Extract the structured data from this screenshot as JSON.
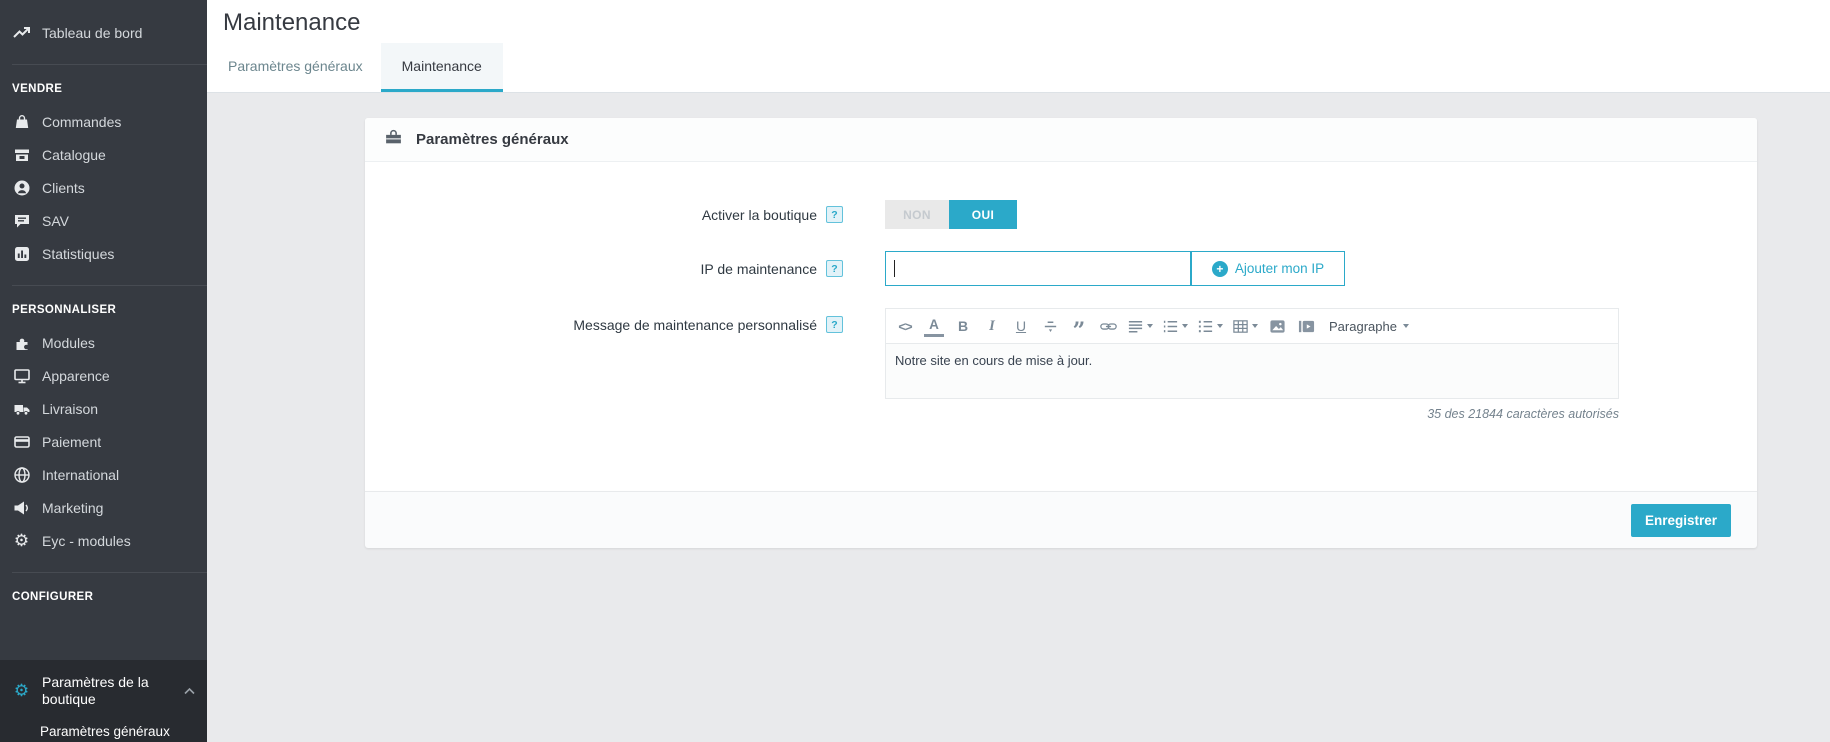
{
  "colors": {
    "accent": "#2ba9c9",
    "sidebar_bg": "#363a41",
    "sidebar_active_bg": "#282b30",
    "page_bg": "#e9eaec"
  },
  "page_title": "Maintenance",
  "tabs": [
    {
      "label": "Paramètres généraux",
      "active": false
    },
    {
      "label": "Maintenance",
      "active": true
    }
  ],
  "sidebar": {
    "dashboard": {
      "label": "Tableau de bord",
      "icon": "trending-up-icon"
    },
    "sections": [
      {
        "title": "VENDRE",
        "items": [
          {
            "label": "Commandes",
            "icon": "shopping-bag-icon"
          },
          {
            "label": "Catalogue",
            "icon": "store-icon"
          },
          {
            "label": "Clients",
            "icon": "user-circle-icon"
          },
          {
            "label": "SAV",
            "icon": "chat-bubble-icon"
          },
          {
            "label": "Statistiques",
            "icon": "bar-chart-icon"
          }
        ]
      },
      {
        "title": "PERSONNALISER",
        "items": [
          {
            "label": "Modules",
            "icon": "puzzle-icon"
          },
          {
            "label": "Apparence",
            "icon": "monitor-icon"
          },
          {
            "label": "Livraison",
            "icon": "truck-icon"
          },
          {
            "label": "Paiement",
            "icon": "credit-card-icon"
          },
          {
            "label": "International",
            "icon": "globe-icon"
          },
          {
            "label": "Marketing",
            "icon": "megaphone-icon"
          },
          {
            "label": "Eyc - modules",
            "icon": "gear-icon"
          }
        ]
      },
      {
        "title": "CONFIGURER",
        "items": [
          {
            "label": "Paramètres de la boutique",
            "icon": "gear-icon",
            "active": true
          }
        ],
        "submenu": [
          {
            "label": "Paramètres généraux"
          }
        ]
      }
    ]
  },
  "panel": {
    "heading": "Paramètres généraux",
    "icon": "briefcase-icon"
  },
  "form": {
    "shop_enable": {
      "label": "Activer la boutique",
      "help": "?",
      "off": "NON",
      "on": "OUI",
      "value": "OUI"
    },
    "maintenance_ip": {
      "label": "IP de maintenance",
      "help": "?",
      "value": "",
      "placeholder": "",
      "add_button": "Ajouter mon IP"
    },
    "maintenance_message": {
      "label": "Message de maintenance personnalisé",
      "help": "?",
      "content": "Notre site en cours de mise à jour.",
      "char_count": "35 des 21844 caractères autorisés",
      "paragraph_label": "Paragraphe",
      "toolbar_icons": [
        "code-icon",
        "text-color-icon",
        "bold-icon",
        "italic-icon",
        "underline-icon",
        "strikethrough-icon",
        "blockquote-icon",
        "link-icon",
        "align-icon",
        "unordered-list-icon",
        "ordered-list-icon",
        "table-icon",
        "image-icon",
        "media-icon",
        "paragraph-dropdown"
      ]
    }
  },
  "footer": {
    "save_label": "Enregistrer"
  }
}
